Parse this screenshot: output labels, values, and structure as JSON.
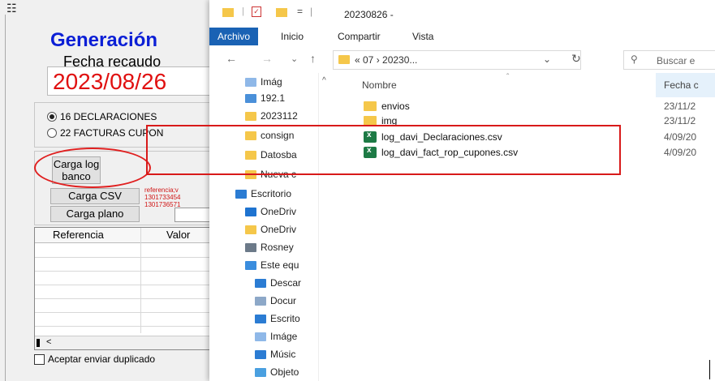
{
  "app": {
    "title": "Generación",
    "fecha_label": "Fecha recaudo",
    "fecha_value": "2023/08/26",
    "radios": [
      {
        "label": "16 DECLARACIONES",
        "selected": true
      },
      {
        "label": "22 FACTURAS CUPON",
        "selected": false
      }
    ],
    "carga_log_line1": "Carga log",
    "carga_log_line2": "banco",
    "carga_csv": "Carga CSV",
    "carga_plano": "Carga plano",
    "ref_text_1": "referencia;v",
    "ref_text_2": "1301733454",
    "ref_text_3": "1301736571",
    "grid_headers": [
      "Referencia",
      "Valor"
    ],
    "scroll_arrow": "<",
    "checkbox_label": "Aceptar enviar duplicado"
  },
  "explorer": {
    "title": "20230826 -",
    "title_sep": "=",
    "tabs": [
      "Archivo",
      "Inicio",
      "Compartir",
      "Vista"
    ],
    "address_path": "«  07  ›  20230...",
    "search_placeholder": "Buscar e",
    "nav_items": [
      {
        "label": "Imág",
        "color": "#8fb8e8"
      },
      {
        "label": "192.1",
        "color": "#4a90d9"
      },
      {
        "label": "2023112",
        "color": "#f5c74a"
      },
      {
        "label": "consign",
        "color": "#f5c74a"
      },
      {
        "label": "Datosba",
        "color": "#f5c74a"
      },
      {
        "label": "Nueva c",
        "color": "#f5c74a"
      },
      {
        "label": "Escritorio",
        "color": "#2b7cd3"
      },
      {
        "label": "OneDriv",
        "color": "#1e73d0"
      },
      {
        "label": "OneDriv",
        "color": "#f5c74a"
      },
      {
        "label": "Rosney",
        "color": "#6c7a89"
      },
      {
        "label": "Este equ",
        "color": "#3a8dde"
      },
      {
        "label": "Descar",
        "color": "#2b7cd3"
      },
      {
        "label": "Docur",
        "color": "#8da8c8"
      },
      {
        "label": "Escrito",
        "color": "#2b7cd3"
      },
      {
        "label": "Imáge",
        "color": "#8fb8e8"
      },
      {
        "label": "Músic",
        "color": "#2b7cd3"
      },
      {
        "label": "Objeto",
        "color": "#4aa0e0"
      }
    ],
    "column_name": "Nombre",
    "column_date": "Fecha c",
    "files": [
      {
        "name": "envios",
        "date": "23/11/2",
        "type": "folder"
      },
      {
        "name": "img",
        "date": "23/11/2",
        "type": "folder"
      },
      {
        "name": "log_davi_Declaraciones.csv",
        "date": "4/09/20",
        "type": "csv"
      },
      {
        "name": "log_davi_fact_rop_cupones.csv",
        "date": "4/09/20",
        "type": "csv"
      }
    ]
  }
}
